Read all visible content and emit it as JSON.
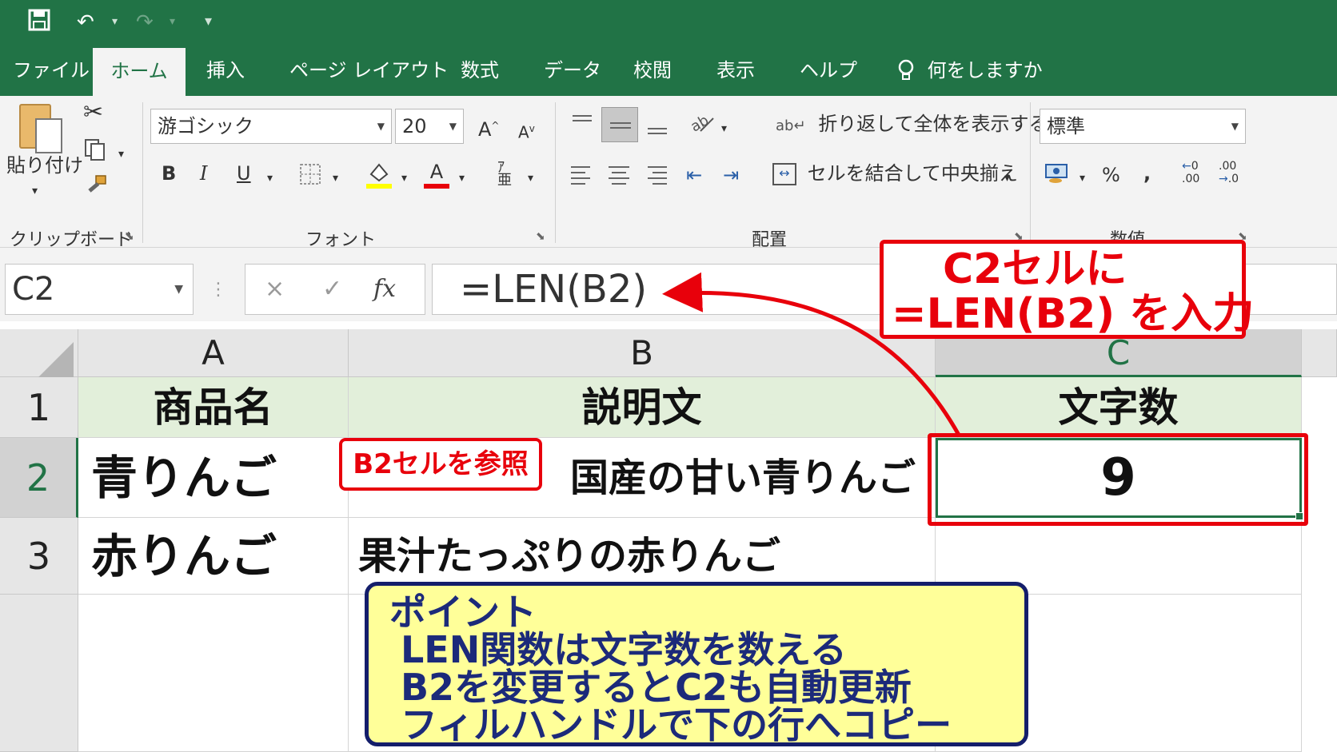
{
  "quick_access": {
    "save_icon": "save-icon",
    "undo_icon": "undo-icon",
    "redo_icon": "redo-icon",
    "customize_icon": "customize-qat-icon"
  },
  "tabs": [
    {
      "label": "ファイル"
    },
    {
      "label": "ホーム"
    },
    {
      "label": "挿入"
    },
    {
      "label": "ページ レイアウト"
    },
    {
      "label": "数式"
    },
    {
      "label": "データ"
    },
    {
      "label": "校閲"
    },
    {
      "label": "表示"
    },
    {
      "label": "ヘルプ"
    },
    {
      "label": "何をしますか"
    }
  ],
  "ribbon": {
    "clipboard": {
      "paste_label": "貼り付け",
      "group_label": "クリップボード"
    },
    "font": {
      "font_name": "游ゴシック",
      "font_size": "20",
      "bold": "B",
      "italic": "I",
      "underline": "U",
      "font_color_glyph": "A",
      "grow": "A",
      "shrink": "A",
      "group_label": "フォント"
    },
    "alignment": {
      "wrap_text": "折り返して全体を表示する",
      "merge_center": "セルを結合して中央揃え",
      "group_label": "配置"
    },
    "number": {
      "format": "標準",
      "percent": "%",
      "comma": ",",
      "group_label": "数値"
    }
  },
  "formula_bar": {
    "name_box": "C2",
    "cancel": "×",
    "enter": "✓",
    "fx": "fx",
    "formula": "=LEN(B2)"
  },
  "sheet": {
    "columns": [
      "A",
      "B",
      "C"
    ],
    "rows": [
      "1",
      "2",
      "3"
    ],
    "cells": {
      "A1": "商品名",
      "B1": "説明文",
      "C1": "文字数",
      "A2": "青りんご",
      "B2": "国産の甘い青りんご",
      "C2": "9",
      "A3": "赤りんご",
      "B3": "果汁たっぷりの赤りんご",
      "C3": ""
    }
  },
  "annotations": {
    "callout_line1": "C2セルに",
    "callout_line2": "=LEN(B2) を入力",
    "ref_tag": "B2セルを参照",
    "point_title": "ポイント",
    "point_lines": [
      "LEN関数は文字数を数える",
      "B2を変更するとC2も自動更新",
      "フィルハンドルで下の行へコピー"
    ]
  },
  "colors": {
    "excel_green": "#217346",
    "annotation_red": "#e8000b",
    "header_fill": "#e2efda",
    "point_fill": "#ffff99",
    "point_text": "#1c2a7a"
  }
}
